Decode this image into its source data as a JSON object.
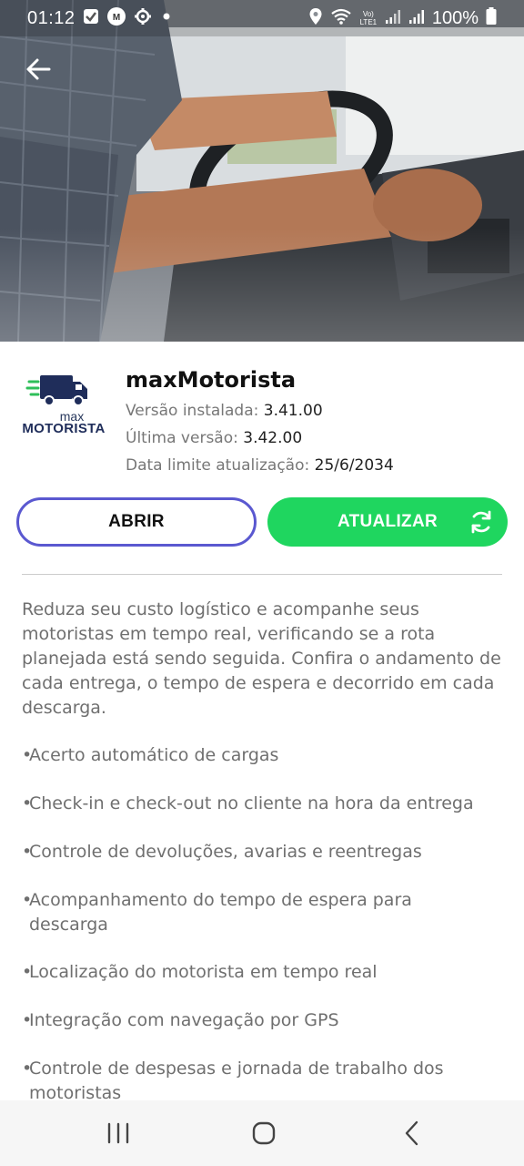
{
  "status_bar": {
    "time": "01:12",
    "battery": "100%",
    "network_label": "Vo) LTE1",
    "left_icons": [
      "checkbox-notification-icon",
      "m-notification-icon",
      "settings-gear-icon",
      "dot-icon"
    ],
    "right_icons": [
      "location-icon",
      "wifi-icon",
      "signal-icon",
      "signal-icon-2",
      "battery-icon"
    ]
  },
  "header": {
    "back_icon": "arrow-left-icon"
  },
  "app": {
    "logo_max": "max",
    "logo_motorista": "MOTORISTA",
    "title": "maxMotorista",
    "installed_label": "Versão instalada:",
    "installed_value": "3.41.00",
    "latest_label": "Última versão:",
    "latest_value": "3.42.00",
    "deadline_label": "Data limite atualização:",
    "deadline_value": "25/6/2034"
  },
  "buttons": {
    "open": "ABRIR",
    "update": "ATUALIZAR"
  },
  "description": "Reduza seu custo logístico e acompanhe seus motoristas em tempo real, verificando se a rota planejada está sendo seguida. Confira o andamento de cada entrega, o tempo de espera e decorrido em cada descarga.",
  "features": [
    "Acerto automático de cargas",
    "Check-in e check-out no cliente na hora da entrega",
    "Controle de devoluções, avarias e reentregas",
    "Acompanhamento do tempo de espera para descarga",
    "Localização do motorista em tempo real",
    "Integração com navegação por GPS",
    "Controle de despesas e jornada de trabalho dos motoristas"
  ],
  "colors": {
    "accent_green": "#1fd65f",
    "open_border": "#5a58d0",
    "logo_blue": "#1f2d5a",
    "logo_green": "#2fbf5a"
  }
}
